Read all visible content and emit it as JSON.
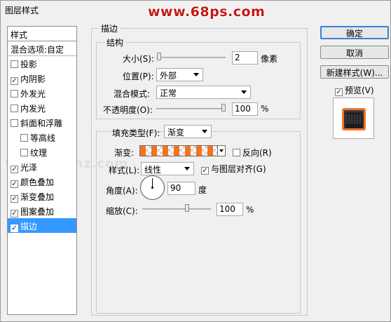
{
  "window": {
    "title": "图层样式",
    "watermark": "www.68ps.com",
    "bg_watermark": "www.psahz.com"
  },
  "left_panel": {
    "header": "样式",
    "items": [
      {
        "label": "混合选项:自定",
        "checkbox": false,
        "checked": false,
        "indent": false,
        "selected": false
      },
      {
        "label": "投影",
        "checkbox": true,
        "checked": false,
        "indent": false,
        "selected": false
      },
      {
        "label": "内阴影",
        "checkbox": true,
        "checked": true,
        "indent": false,
        "selected": false
      },
      {
        "label": "外发光",
        "checkbox": true,
        "checked": false,
        "indent": false,
        "selected": false
      },
      {
        "label": "内发光",
        "checkbox": true,
        "checked": false,
        "indent": false,
        "selected": false
      },
      {
        "label": "斜面和浮雕",
        "checkbox": true,
        "checked": false,
        "indent": false,
        "selected": false
      },
      {
        "label": "等高线",
        "checkbox": true,
        "checked": false,
        "indent": true,
        "selected": false
      },
      {
        "label": "纹理",
        "checkbox": true,
        "checked": false,
        "indent": true,
        "selected": false
      },
      {
        "label": "光泽",
        "checkbox": true,
        "checked": true,
        "indent": false,
        "selected": false
      },
      {
        "label": "颜色叠加",
        "checkbox": true,
        "checked": true,
        "indent": false,
        "selected": false
      },
      {
        "label": "渐变叠加",
        "checkbox": true,
        "checked": true,
        "indent": false,
        "selected": false
      },
      {
        "label": "图案叠加",
        "checkbox": true,
        "checked": true,
        "indent": false,
        "selected": false
      },
      {
        "label": "描边",
        "checkbox": true,
        "checked": true,
        "indent": false,
        "selected": true
      }
    ]
  },
  "stroke": {
    "section_title": "描边",
    "structure_title": "结构",
    "size_label": "大小(S):",
    "size_value": "2",
    "size_unit": "像素",
    "size_slider": 0.01,
    "position_label": "位置(P):",
    "position_value": "外部",
    "blend_label": "混合模式:",
    "blend_value": "正常",
    "opacity_label": "不透明度(O):",
    "opacity_value": "100",
    "opacity_unit": "%",
    "opacity_slider": 1.0
  },
  "fill": {
    "fill_type_label": "填充类型(F):",
    "fill_type_value": "渐变",
    "gradient_label": "渐变:",
    "reverse_label": "反向(R)",
    "reverse_checked": false,
    "style_label": "样式(L):",
    "style_value": "线性",
    "align_label": "与图层对齐(G)",
    "align_checked": true,
    "angle_label": "角度(A):",
    "angle_value": "90",
    "angle_unit": "度",
    "scale_label": "缩放(C):",
    "scale_value": "100",
    "scale_unit": "%",
    "scale_slider": 0.66,
    "gradient_colors": [
      "#f4731e",
      "#ffffff"
    ]
  },
  "buttons": {
    "ok": "确定",
    "cancel": "取消",
    "new_style": "新建样式(W)...",
    "preview_label": "预览(V)",
    "preview_checked": true
  },
  "colors": {
    "selection": "#3399ff",
    "watermark": "#c21b16",
    "accent_orange": "#f07330"
  }
}
